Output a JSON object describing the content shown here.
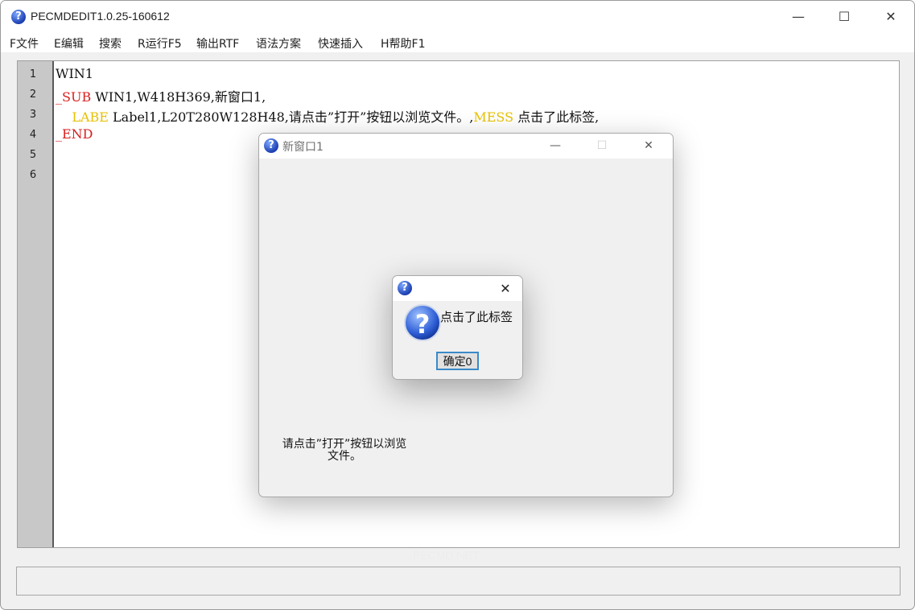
{
  "app": {
    "title": "PECMDEDIT1.0.25-160612",
    "minimize_glyph": "—",
    "maximize_glyph": "☐",
    "close_glyph": "✕",
    "icon": "question-icon"
  },
  "menu": [
    {
      "label": "F文件"
    },
    {
      "label": "E编辑"
    },
    {
      "label": "搜索"
    },
    {
      "label": "R运行F5"
    },
    {
      "label": "输出RTF"
    },
    {
      "label": "语法方案"
    },
    {
      "label": "快速插入"
    },
    {
      "label": "H帮助F1"
    }
  ],
  "editor": {
    "line_numbers": [
      "1",
      "2",
      "3",
      "4",
      "5",
      "6"
    ],
    "lines": [
      {
        "plain": "WIN1"
      },
      {
        "kw": "_SUB",
        "rest": " WIN1,W418H369,新窗口1,"
      },
      {
        "indent": "    ",
        "kw": "LABE",
        "mid": " Label1,L20T280W128H48,请点击”打开”按钮以浏览文件。,",
        "kw2": "MESS",
        "rest": " 点击了此标签,"
      },
      {
        "kw": "_END"
      }
    ],
    "colors": {
      "sub_end": "#d81f1f",
      "labe_mess": "#e8c000",
      "gutter": "#c8c8c8"
    }
  },
  "watermark": "PECMD.NET",
  "child_window": {
    "title": "新窗口1",
    "label_text": "请点击”打开”按钮以浏览文件。"
  },
  "message_box": {
    "text": "点击了此标签",
    "button": "确定0",
    "close_glyph": "✕",
    "icon": "question-icon"
  }
}
